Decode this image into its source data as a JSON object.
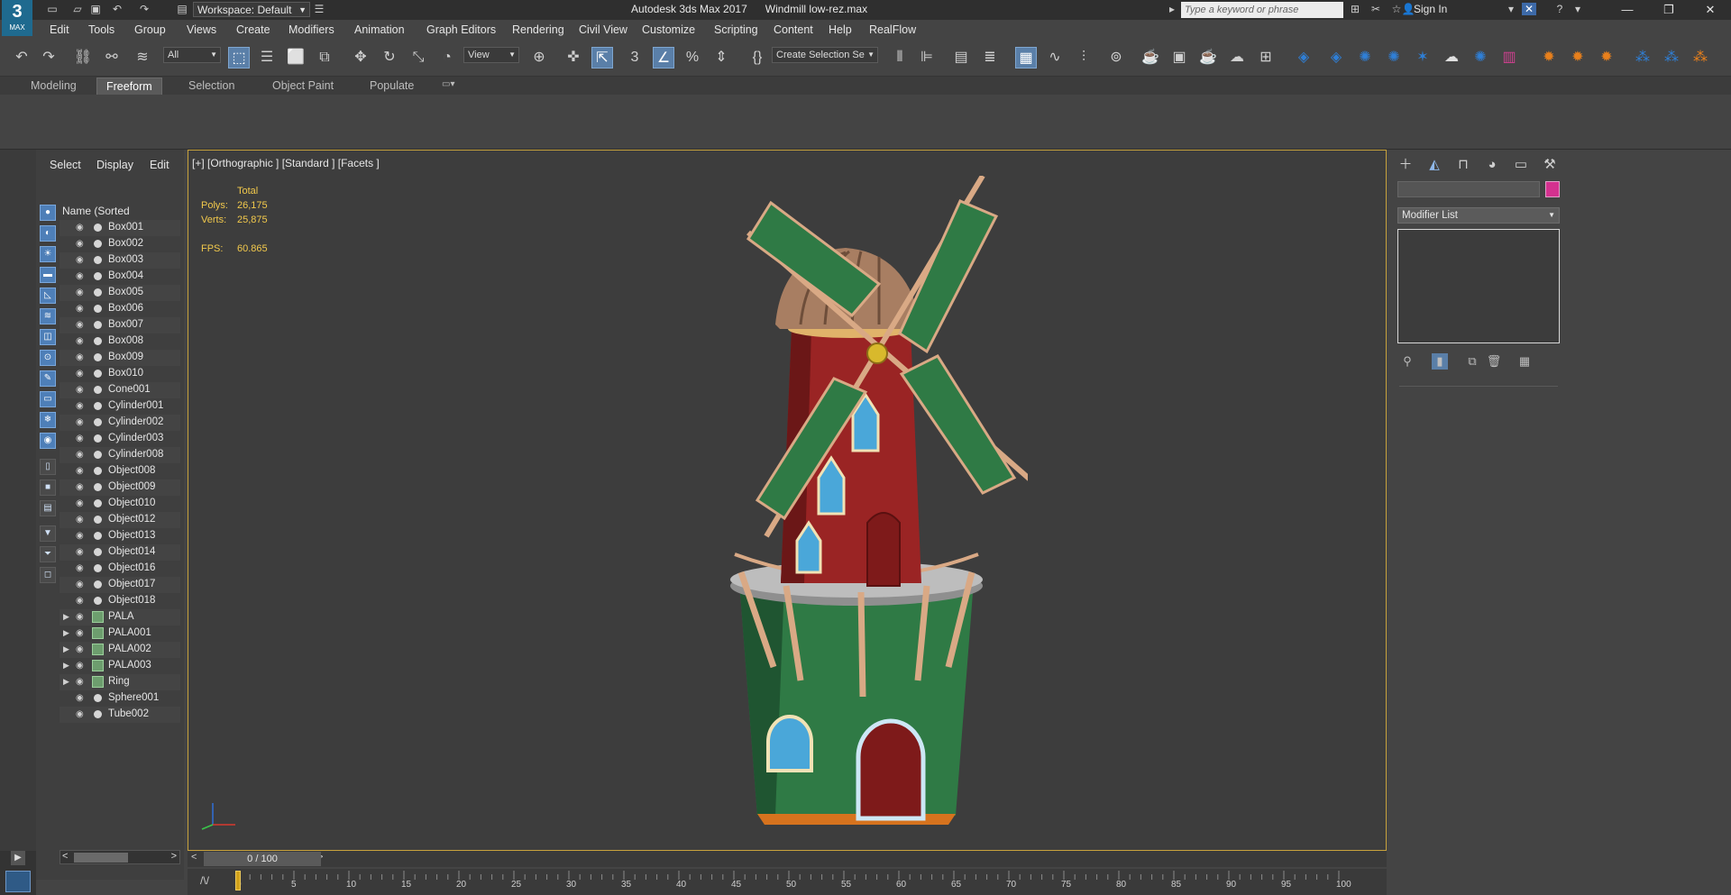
{
  "app": {
    "logo_text": "3",
    "logo_sub": "MAX",
    "title": "Autodesk 3ds Max 2017      Windmill low-rez.max",
    "workspace": "Workspace: Default",
    "search_placeholder": "Type a keyword or phrase",
    "sign_in": "Sign In"
  },
  "menu": [
    "Edit",
    "Tools",
    "Group",
    "Views",
    "Create",
    "Modifiers",
    "Animation",
    "Graph Editors",
    "Rendering",
    "Civil View",
    "Customize",
    "Scripting",
    "Content",
    "Help",
    "RealFlow"
  ],
  "toolbar": {
    "filter": "All",
    "ref_coord": "View",
    "selection_set": "Create Selection Se"
  },
  "ribbon_tabs": [
    "Modeling",
    "Freeform",
    "Selection",
    "Object Paint",
    "Populate"
  ],
  "ribbon_active": "Freeform",
  "scene_explorer": {
    "tabs": [
      "Select",
      "Display",
      "Edit"
    ],
    "column_header": "Name (Sorted Ascending)",
    "objects": [
      "Box001",
      "Box002",
      "Box003",
      "Box004",
      "Box005",
      "Box006",
      "Box007",
      "Box008",
      "Box009",
      "Box010",
      "Cone001",
      "Cylinder001",
      "Cylinder002",
      "Cylinder003",
      "Cylinder008",
      "Object008",
      "Object009",
      "Object010",
      "Object012",
      "Object013",
      "Object014",
      "Object016",
      "Object017",
      "Object018",
      "PALA",
      "PALA001",
      "PALA002",
      "PALA003",
      "Ring",
      "Sphere001",
      "Tube002"
    ],
    "groups": [
      "PALA",
      "PALA001",
      "PALA002",
      "PALA003",
      "Ring"
    ]
  },
  "viewport": {
    "label": "[+] [Orthographic ] [Standard ] [Facets ]",
    "stats_total": "Total",
    "polys_label": "Polys:",
    "polys_value": "26,175",
    "verts_label": "Verts:",
    "verts_value": "25,875",
    "fps_label": "FPS:",
    "fps_value": "60.865"
  },
  "command_panel": {
    "modifier_list": "Modifier List",
    "object_color": "#d4318f"
  },
  "timeline": {
    "slider_text": "0 / 100",
    "ticks": [
      "0",
      "5",
      "10",
      "15",
      "20",
      "25",
      "30",
      "35",
      "40",
      "45",
      "50",
      "55",
      "60",
      "65",
      "70",
      "75",
      "80",
      "85",
      "90",
      "95",
      "100"
    ]
  }
}
